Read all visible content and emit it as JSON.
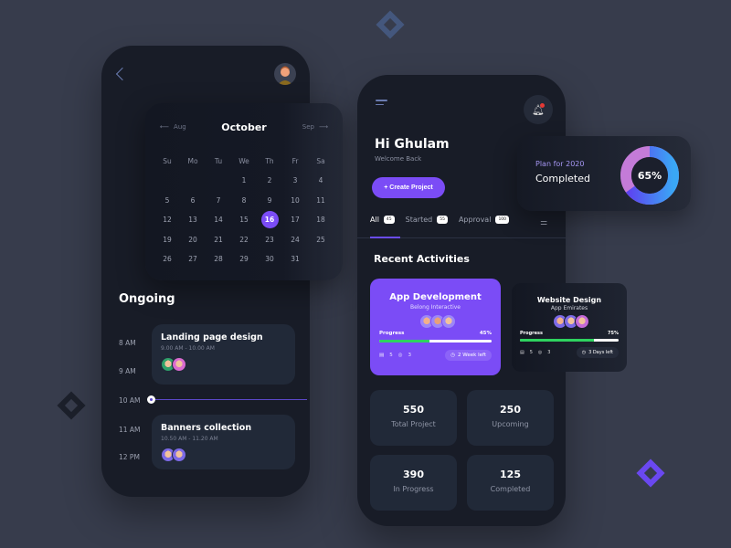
{
  "calendar_screen": {
    "back_icon": "chevron-left-icon",
    "avatar_icon": "user-avatar-male",
    "calendar": {
      "month": "October",
      "prev_month": "Aug",
      "next_month": "Sep",
      "weekdays": [
        "Su",
        "Mo",
        "Tu",
        "We",
        "Th",
        "Fr",
        "Sa"
      ],
      "first_weekday_index": 3,
      "days_in_month": 31,
      "selected_day": "16"
    },
    "ongoing_title": "Ongoing",
    "time_labels": [
      "8 AM",
      "9 AM",
      "10 AM",
      "11 AM",
      "12 PM"
    ],
    "events": [
      {
        "title": "Landing page design",
        "time": "9.00 AM - 10.00 AM"
      },
      {
        "title": "Banners collection",
        "time": "10.50 AM - 11.20 AM"
      }
    ]
  },
  "dashboard_screen": {
    "menu_icon": "hamburger-menu-icon",
    "bell_icon": "notification-bell-icon",
    "greeting": "Hi Ghulam",
    "welcome": "Welcome Back",
    "create_button": "+ Create Project",
    "tabs": [
      {
        "label": "All",
        "count": "45",
        "active": true
      },
      {
        "label": "Started",
        "count": "55",
        "active": false
      },
      {
        "label": "Approval",
        "count": "100",
        "active": false
      }
    ],
    "filter_icon": "sliders-filter-icon",
    "recent_title": "Recent Activities",
    "activities": [
      {
        "title": "App Development",
        "subtitle": "Belong Interactive",
        "progress_label": "Progress",
        "progress": "45%",
        "progress_value": 45,
        "files": "5",
        "comments": "3",
        "time_left": "2 Week left"
      },
      {
        "title": "Website Design",
        "subtitle": "App Emirates",
        "progress_label": "Progress",
        "progress": "75%",
        "progress_value": 75,
        "files": "5",
        "comments": "3",
        "time_left": "3 Days left"
      }
    ],
    "stats": [
      {
        "value": "550",
        "label": "Total Project"
      },
      {
        "value": "250",
        "label": "Upcoming"
      },
      {
        "value": "390",
        "label": "In Progress"
      },
      {
        "value": "125",
        "label": "Completed"
      }
    ]
  },
  "plan_card": {
    "title": "Plan for 2020",
    "status": "Completed",
    "percent_label": "65%",
    "percent_value": 65
  },
  "colors": {
    "accent": "#7b4cf6",
    "progress_green": "#2ed35f",
    "background": "#373c4c",
    "phone_bg": "#181c27",
    "card_bg": "#212938"
  }
}
